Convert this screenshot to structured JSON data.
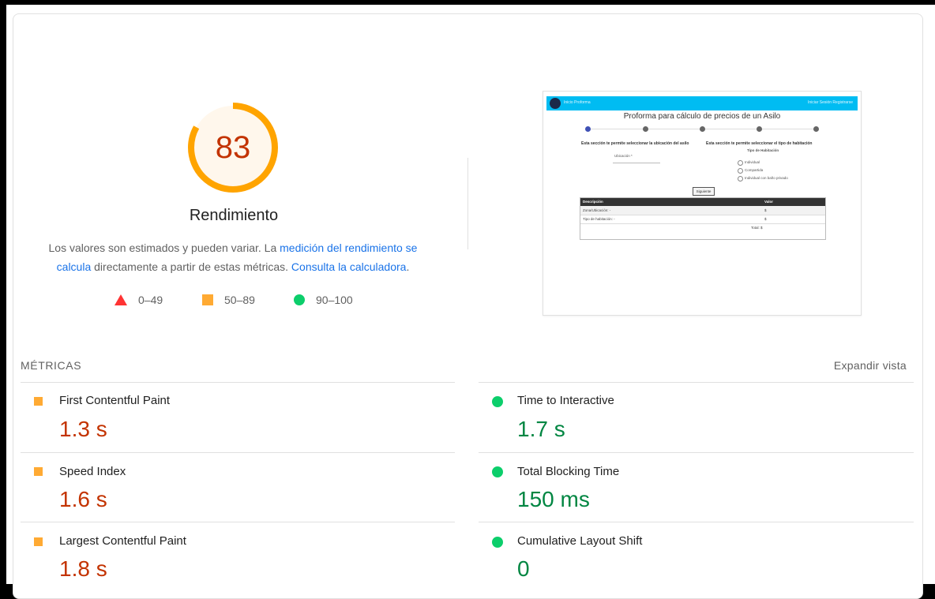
{
  "summary": {
    "score": "83",
    "title": "Rendimiento",
    "desc_part1": "Los valores son estimados y pueden variar. La ",
    "desc_link1": "medición del rendimiento se calcula",
    "desc_part2": " directamente a partir de estas métricas. ",
    "desc_link2": "Consulta la calculadora",
    "desc_part3": ".",
    "gauge_fraction": 0.83,
    "gauge_color": "#ffa400"
  },
  "legend": [
    {
      "icon": "triangle-icon",
      "label": "0–49",
      "color": "#ff3333"
    },
    {
      "icon": "square-icon",
      "label": "50–89",
      "color": "#ffaa33"
    },
    {
      "icon": "circle-icon",
      "label": "90–100",
      "color": "#0cce6b"
    }
  ],
  "screenshot": {
    "nav_left": "Inicio  Proforma",
    "nav_right": "Iniciar Sesión  Registrarse",
    "title": "Proforma para cálculo de precios de un Asilo",
    "section_left": "Esta sección te permite seleccionar la ubicación del asilo",
    "section_right": "Esta sección te permite seleccionar el tipo de habitación",
    "select_label": "Ubicación *",
    "room_type_label": "Tipo de Habitación",
    "options": [
      "Individual",
      "Compartida",
      "Individual con baño privado"
    ],
    "button": "Siguiente",
    "table_headers": [
      "Descripción",
      "Valor"
    ],
    "rows": [
      {
        "desc": "Zona/Ubicación: -",
        "val": "$"
      },
      {
        "desc": "Tipo de habitación: -",
        "val": "$"
      },
      {
        "desc": "",
        "val": "Total:  $"
      }
    ]
  },
  "metrics": {
    "header": "MÉTRICAS",
    "expand": "Expandir vista",
    "items": [
      {
        "label": "First Contentful Paint",
        "value": "1.3 s",
        "status": "average"
      },
      {
        "label": "Time to Interactive",
        "value": "1.7 s",
        "status": "pass"
      },
      {
        "label": "Speed Index",
        "value": "1.6 s",
        "status": "average"
      },
      {
        "label": "Total Blocking Time",
        "value": "150 ms",
        "status": "pass"
      },
      {
        "label": "Largest Contentful Paint",
        "value": "1.8 s",
        "status": "average"
      },
      {
        "label": "Cumulative Layout Shift",
        "value": "0",
        "status": "pass"
      }
    ]
  }
}
